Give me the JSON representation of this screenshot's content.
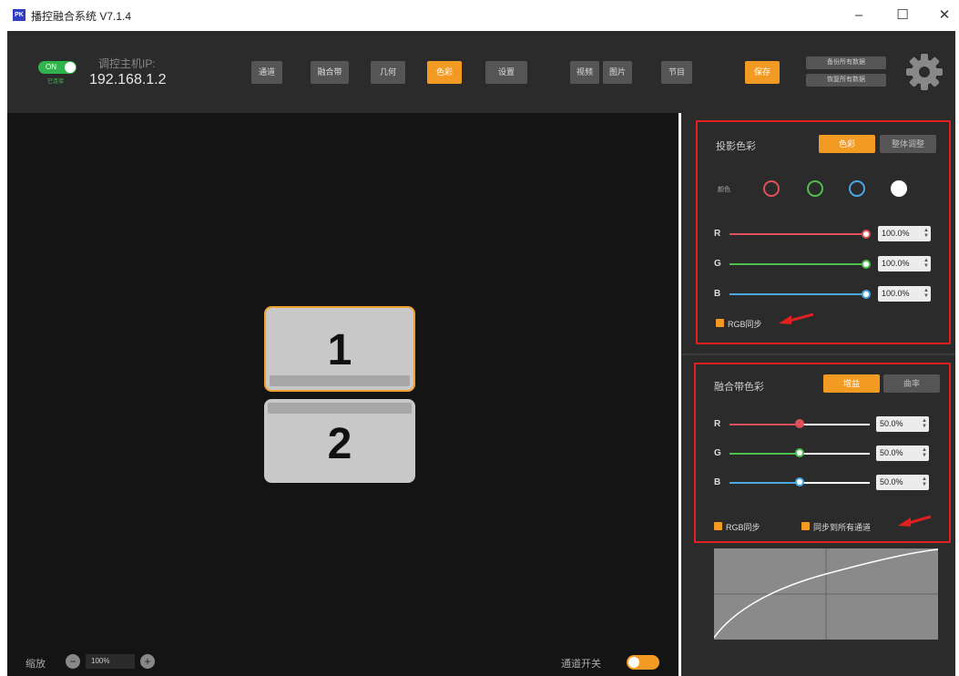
{
  "app": {
    "icon_text": "PK",
    "title": "播控融合系统 V7.1.4"
  },
  "window_controls": {
    "minimize": "–",
    "maximize": "☐",
    "close": "✕"
  },
  "connection": {
    "switch_label": "ON",
    "sub_status": "已连接",
    "ip_label": "调控主机IP:",
    "ip_value": "192.168.1.2"
  },
  "toolbar": {
    "tabs": [
      {
        "label": "通道",
        "active": false
      },
      {
        "label": "融合带",
        "active": false
      },
      {
        "label": "几何",
        "active": false
      },
      {
        "label": "色彩",
        "active": true
      },
      {
        "label": "设置",
        "active": false
      }
    ],
    "media": [
      {
        "label": "视频"
      },
      {
        "label": "图片"
      },
      {
        "label": "节目"
      }
    ],
    "save_label": "保存",
    "load_all_label": "备份所有数据",
    "restore_all_label": "恢复所有数据"
  },
  "canvas": {
    "screens": [
      {
        "label": "1",
        "selected": true
      },
      {
        "label": "2",
        "selected": false
      }
    ]
  },
  "bottom": {
    "zoom_label": "缩放",
    "zoom_minus": "−",
    "zoom_value": "100%",
    "zoom_plus": "+",
    "channel_switch_label": "通道开关"
  },
  "projection_color": {
    "title": "投影色彩",
    "tab_active": "色彩",
    "tab_inactive": "整体调整",
    "color_label": "颜色",
    "swatches": [
      {
        "name": "red",
        "color": "#e0505a"
      },
      {
        "name": "green",
        "color": "#4fbf4f"
      },
      {
        "name": "blue",
        "color": "#4aa8e0"
      },
      {
        "name": "white",
        "color": "#ffffff"
      }
    ],
    "sliders": [
      {
        "label": "R",
        "value": "100.0%",
        "level": 1.0,
        "color": "#e0505a"
      },
      {
        "label": "G",
        "value": "100.0%",
        "level": 1.0,
        "color": "#4fbf4f"
      },
      {
        "label": "B",
        "value": "100.0%",
        "level": 1.0,
        "color": "#4aa8e0"
      }
    ],
    "sync_label": "RGB同步"
  },
  "blend_color": {
    "title": "融合带色彩",
    "tab_active": "增益",
    "tab_inactive": "曲率",
    "sliders": [
      {
        "label": "R",
        "value": "50.0%",
        "level": 0.5,
        "color": "#e0505a"
      },
      {
        "label": "G",
        "value": "50.0%",
        "level": 0.5,
        "color": "#4fbf4f"
      },
      {
        "label": "B",
        "value": "50.0%",
        "level": 0.5,
        "color": "#4aa8e0"
      }
    ],
    "sync_label": "RGB同步",
    "sync_all_label": "同步到所有通道"
  },
  "colors": {
    "accent": "#f39a22",
    "highlight": "#e02020"
  }
}
